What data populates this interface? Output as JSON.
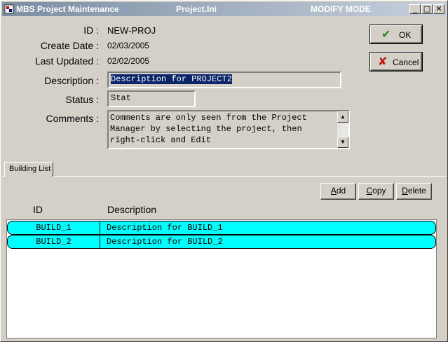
{
  "titlebar": {
    "app_title": "MBS Project Maintenance",
    "file_name": "Project.Ini",
    "mode": "MODIFY MODE",
    "minimize_glyph": "_",
    "maximize_glyph": "□",
    "close_glyph": "✕"
  },
  "form": {
    "id_label": "ID :",
    "id_value": "NEW-PROJ",
    "create_date_label": "Create Date :",
    "create_date_value": "02/03/2005",
    "last_updated_label": "Last Updated :",
    "last_updated_value": "02/02/2005",
    "description_label": "Description :",
    "description_value": "Description for PROJECT2",
    "status_label": "Status :",
    "status_value": "Stat",
    "comments_label": "Comments :",
    "comments_value": "Comments are only seen from the Project\nManager by selecting the project, then\nright-click and Edit"
  },
  "buttons": {
    "ok_label": "OK",
    "ok_icon": "check-icon",
    "ok_color": "#1a8a1a",
    "cancel_label": "Cancel",
    "cancel_icon": "x-icon",
    "cancel_color": "#c01010",
    "add_label": "Add",
    "copy_label": "Copy",
    "delete_label": "Delete"
  },
  "tabs": [
    {
      "label": "Building List",
      "active": true
    }
  ],
  "building_list": {
    "columns": [
      "ID",
      "Description"
    ],
    "rows": [
      {
        "id": "BUILD_1",
        "description": "Description for BUILD_1"
      },
      {
        "id": "BUILD_2",
        "description": "Description for BUILD_2"
      }
    ],
    "row_color": "#00ffff"
  }
}
